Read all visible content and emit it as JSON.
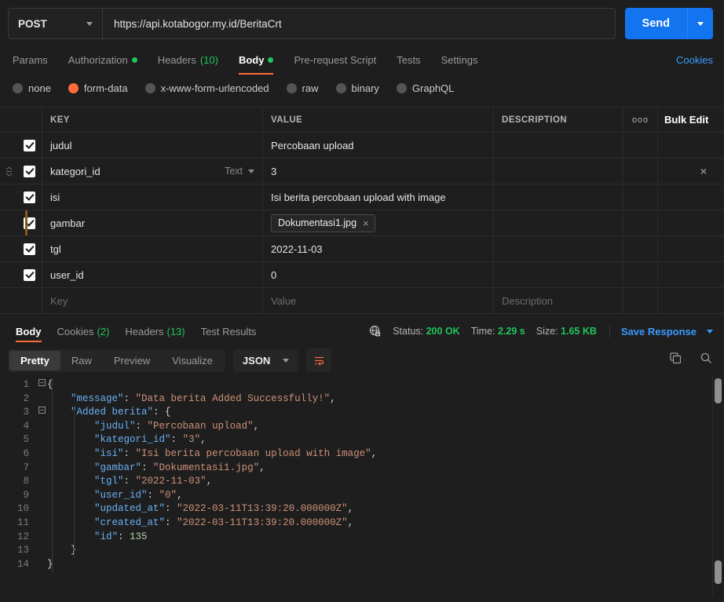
{
  "request": {
    "method": "POST",
    "url": "https://api.kotabogor.my.id/BeritaCrt",
    "send_label": "Send",
    "cookies_label": "Cookies",
    "tabs": [
      {
        "label": "Params",
        "badge": "",
        "dot": false,
        "active": false
      },
      {
        "label": "Authorization",
        "badge": "",
        "dot": true,
        "active": false
      },
      {
        "label": "Headers",
        "badge": "(10)",
        "dot": false,
        "active": false
      },
      {
        "label": "Body",
        "badge": "",
        "dot": true,
        "active": true
      },
      {
        "label": "Pre-request Script",
        "badge": "",
        "dot": false,
        "active": false
      },
      {
        "label": "Tests",
        "badge": "",
        "dot": false,
        "active": false
      },
      {
        "label": "Settings",
        "badge": "",
        "dot": false,
        "active": false
      }
    ],
    "body_types": [
      {
        "label": "none",
        "selected": false
      },
      {
        "label": "form-data",
        "selected": true
      },
      {
        "label": "x-www-form-urlencoded",
        "selected": false
      },
      {
        "label": "raw",
        "selected": false
      },
      {
        "label": "binary",
        "selected": false
      },
      {
        "label": "GraphQL",
        "selected": false
      }
    ]
  },
  "table": {
    "headers": {
      "key": "KEY",
      "value": "VALUE",
      "description": "DESCRIPTION",
      "more": "ooo",
      "bulk_edit": "Bulk Edit"
    },
    "placeholders": {
      "key": "Key",
      "value": "Value",
      "description": "Description"
    },
    "rows": [
      {
        "checked": true,
        "key": "judul",
        "value": "Percobaan upload",
        "description": "",
        "type": "",
        "file": false,
        "drag": false,
        "close": false,
        "accent": false
      },
      {
        "checked": true,
        "key": "kategori_id",
        "value": "3",
        "description": "",
        "type": "Text",
        "file": false,
        "drag": true,
        "close": true,
        "accent": false
      },
      {
        "checked": true,
        "key": "isi",
        "value": "Isi berita percobaan upload with image",
        "description": "",
        "type": "",
        "file": false,
        "drag": false,
        "close": false,
        "accent": false
      },
      {
        "checked": true,
        "key": "gambar",
        "value": "Dokumentasi1.jpg",
        "description": "",
        "type": "",
        "file": true,
        "drag": false,
        "close": false,
        "accent": true
      },
      {
        "checked": true,
        "key": "tgl",
        "value": "2022-11-03",
        "description": "",
        "type": "",
        "file": false,
        "drag": false,
        "close": false,
        "accent": false
      },
      {
        "checked": true,
        "key": "user_id",
        "value": "0",
        "description": "",
        "type": "",
        "file": false,
        "drag": false,
        "close": false,
        "accent": false
      }
    ]
  },
  "response": {
    "tabs": [
      {
        "label": "Body",
        "badge": "",
        "active": true
      },
      {
        "label": "Cookies",
        "badge": "(2)",
        "active": false
      },
      {
        "label": "Headers",
        "badge": "(13)",
        "active": false
      },
      {
        "label": "Test Results",
        "badge": "",
        "active": false
      }
    ],
    "status_label": "Status:",
    "status_value": "200 OK",
    "time_label": "Time:",
    "time_value": "2.29 s",
    "size_label": "Size:",
    "size_value": "1.65 KB",
    "save_response": "Save Response",
    "view_modes": [
      {
        "label": "Pretty",
        "active": true
      },
      {
        "label": "Raw",
        "active": false
      },
      {
        "label": "Preview",
        "active": false
      },
      {
        "label": "Visualize",
        "active": false
      }
    ],
    "format": "JSON",
    "code_lines": [
      {
        "n": "1",
        "fold": "-",
        "parts": [
          {
            "t": "{",
            "c": "tk-pun"
          }
        ],
        "indent": 0
      },
      {
        "n": "2",
        "fold": "",
        "parts": [
          {
            "t": "\"message\"",
            "c": "tk-key"
          },
          {
            "t": ": ",
            "c": "tk-pun"
          },
          {
            "t": "\"Data berita Added Successfully!\"",
            "c": "tk-str"
          },
          {
            "t": ",",
            "c": "tk-pun"
          }
        ],
        "indent": 1
      },
      {
        "n": "3",
        "fold": "-",
        "parts": [
          {
            "t": "\"Added berita\"",
            "c": "tk-key"
          },
          {
            "t": ": {",
            "c": "tk-pun"
          }
        ],
        "indent": 1
      },
      {
        "n": "4",
        "fold": "",
        "parts": [
          {
            "t": "\"judul\"",
            "c": "tk-key"
          },
          {
            "t": ": ",
            "c": "tk-pun"
          },
          {
            "t": "\"Percobaan upload\"",
            "c": "tk-str"
          },
          {
            "t": ",",
            "c": "tk-pun"
          }
        ],
        "indent": 2
      },
      {
        "n": "5",
        "fold": "",
        "parts": [
          {
            "t": "\"kategori_id\"",
            "c": "tk-key"
          },
          {
            "t": ": ",
            "c": "tk-pun"
          },
          {
            "t": "\"3\"",
            "c": "tk-str"
          },
          {
            "t": ",",
            "c": "tk-pun"
          }
        ],
        "indent": 2
      },
      {
        "n": "6",
        "fold": "",
        "parts": [
          {
            "t": "\"isi\"",
            "c": "tk-key"
          },
          {
            "t": ": ",
            "c": "tk-pun"
          },
          {
            "t": "\"Isi berita percobaan upload with image\"",
            "c": "tk-str"
          },
          {
            "t": ",",
            "c": "tk-pun"
          }
        ],
        "indent": 2
      },
      {
        "n": "7",
        "fold": "",
        "parts": [
          {
            "t": "\"gambar\"",
            "c": "tk-key"
          },
          {
            "t": ": ",
            "c": "tk-pun"
          },
          {
            "t": "\"Dokumentasi1.jpg\"",
            "c": "tk-str"
          },
          {
            "t": ",",
            "c": "tk-pun"
          }
        ],
        "indent": 2
      },
      {
        "n": "8",
        "fold": "",
        "parts": [
          {
            "t": "\"tgl\"",
            "c": "tk-key"
          },
          {
            "t": ": ",
            "c": "tk-pun"
          },
          {
            "t": "\"2022-11-03\"",
            "c": "tk-str"
          },
          {
            "t": ",",
            "c": "tk-pun"
          }
        ],
        "indent": 2
      },
      {
        "n": "9",
        "fold": "",
        "parts": [
          {
            "t": "\"user_id\"",
            "c": "tk-key"
          },
          {
            "t": ": ",
            "c": "tk-pun"
          },
          {
            "t": "\"0\"",
            "c": "tk-str"
          },
          {
            "t": ",",
            "c": "tk-pun"
          }
        ],
        "indent": 2
      },
      {
        "n": "10",
        "fold": "",
        "parts": [
          {
            "t": "\"updated_at\"",
            "c": "tk-key"
          },
          {
            "t": ": ",
            "c": "tk-pun"
          },
          {
            "t": "\"2022-03-11T13:39:20.000000Z\"",
            "c": "tk-str"
          },
          {
            "t": ",",
            "c": "tk-pun"
          }
        ],
        "indent": 2
      },
      {
        "n": "11",
        "fold": "",
        "parts": [
          {
            "t": "\"created_at\"",
            "c": "tk-key"
          },
          {
            "t": ": ",
            "c": "tk-pun"
          },
          {
            "t": "\"2022-03-11T13:39:20.000000Z\"",
            "c": "tk-str"
          },
          {
            "t": ",",
            "c": "tk-pun"
          }
        ],
        "indent": 2
      },
      {
        "n": "12",
        "fold": "",
        "parts": [
          {
            "t": "\"id\"",
            "c": "tk-key"
          },
          {
            "t": ": ",
            "c": "tk-pun"
          },
          {
            "t": "135",
            "c": "tk-num"
          }
        ],
        "indent": 2
      },
      {
        "n": "13",
        "fold": "",
        "parts": [
          {
            "t": "}",
            "c": "tk-pun"
          }
        ],
        "indent": 1
      },
      {
        "n": "14",
        "fold": "",
        "parts": [
          {
            "t": "}",
            "c": "tk-pun"
          }
        ],
        "indent": 0
      }
    ]
  },
  "colors": {
    "accent_orange": "#ff6c37",
    "send_blue": "#1374ef",
    "link_blue": "#3b9bff",
    "status_green": "#21c55d",
    "background": "#1e1e1e"
  }
}
